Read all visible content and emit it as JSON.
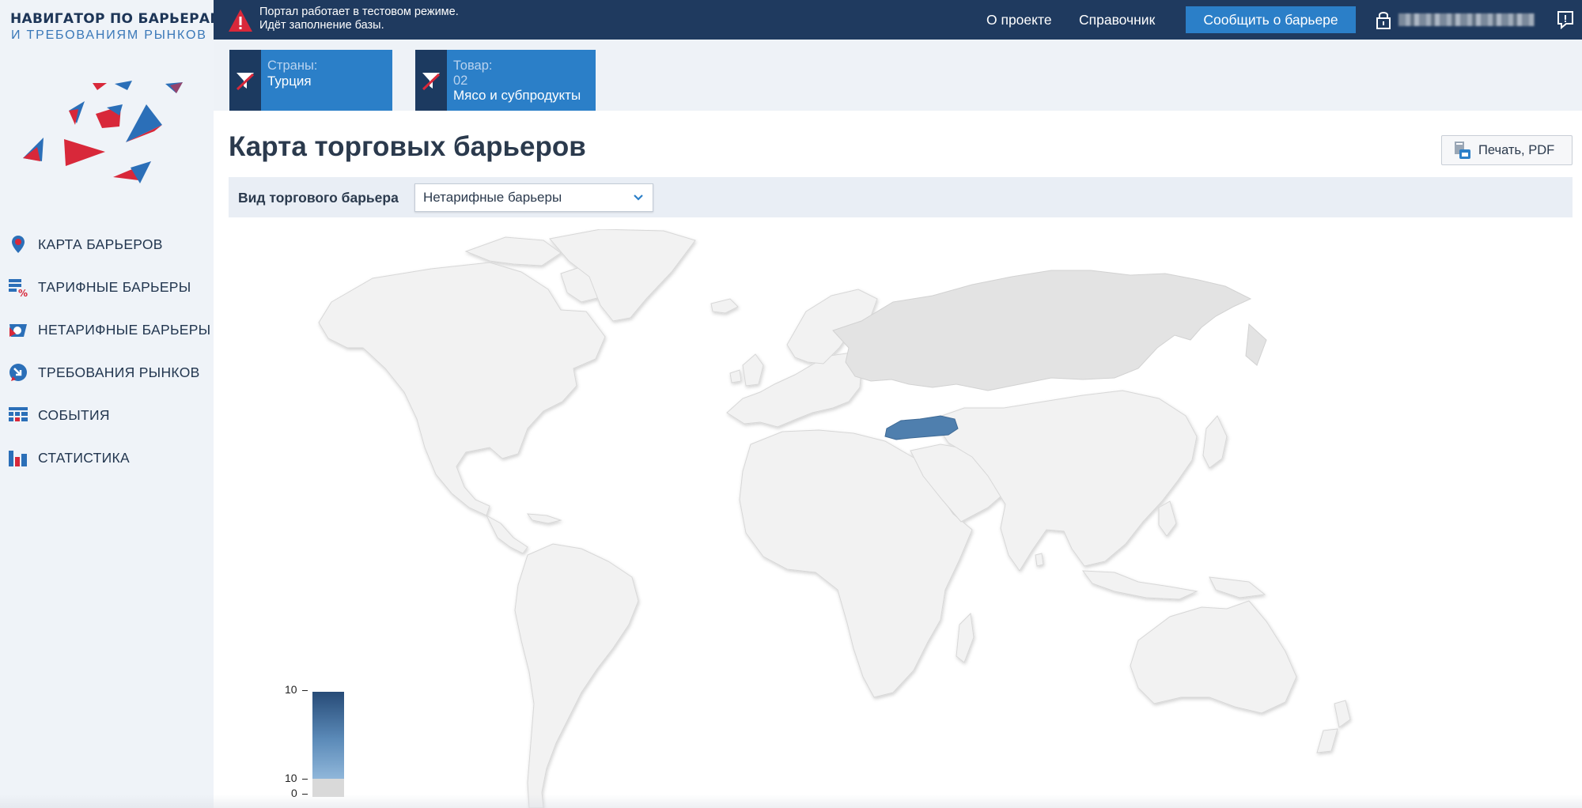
{
  "brand": {
    "title": "НАВИГАТОР ПО БАРЬЕРАМ",
    "subtitle": "И ТРЕБОВАНИЯМ РЫНКОВ"
  },
  "sidebar": {
    "items": [
      {
        "label": "КАРТА БАРЬЕРОВ",
        "icon": "map-pin-icon"
      },
      {
        "label": "ТАРИФНЫЕ БАРЬЕРЫ",
        "icon": "tariff-icon"
      },
      {
        "label": "НЕТАРИФНЫЕ БАРЬЕРЫ",
        "icon": "non-tariff-icon"
      },
      {
        "label": "ТРЕБОВАНИЯ РЫНКОВ",
        "icon": "market-requirements-icon"
      },
      {
        "label": "СОБЫТИЯ",
        "icon": "calendar-icon"
      },
      {
        "label": "СТАТИСТИКА",
        "icon": "statistics-icon"
      }
    ]
  },
  "topbar": {
    "notice_line1": "Портал работает в тестовом режиме.",
    "notice_line2": "Идёт заполнение базы.",
    "about": "О проекте",
    "reference": "Справочник",
    "report_button": "Сообщить о барьере"
  },
  "filters": {
    "countries_caption": "Страны:",
    "countries_value": "Турция",
    "product_caption": "Товар:",
    "product_code": "02",
    "product_value": "Мясо и субпродукты"
  },
  "page": {
    "title": "Карта торговых барьеров",
    "print_button": "Печать, PDF"
  },
  "barrier_type": {
    "label": "Вид торгового барьера",
    "selected": "Нетарифные барьеры"
  },
  "legend": {
    "ticks": [
      "10",
      "10",
      "0"
    ],
    "color_max": "#274b77",
    "color_min": "#a8cbe9",
    "color_zero": "#d9d9d9"
  },
  "map": {
    "highlighted_country": "Турция",
    "highlight_color": "#4f7fae",
    "secondary_country_color": "#e3e3e3",
    "default_country_color": "#f2f2f2"
  },
  "colors": {
    "topbar": "#1f3a5f",
    "accent": "#2b7fc8",
    "sidebar_bg": "#eff3f8"
  }
}
